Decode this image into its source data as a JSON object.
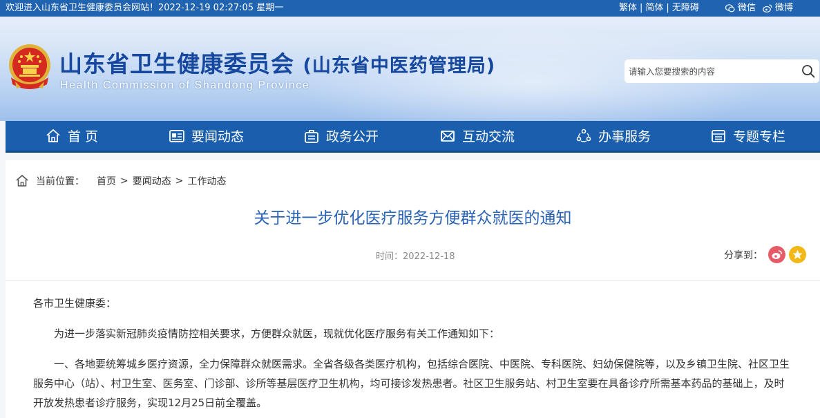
{
  "topbar": {
    "welcome": "欢迎进入山东省卫生健康委员会网站！2022-12-19 02:27:05 星期一",
    "lang_traditional": "繁体",
    "lang_simplified": "简体",
    "accessibility": "无障碍",
    "sep": "|",
    "wechat": "微信",
    "weibo": "微博"
  },
  "header": {
    "title_cn": "山东省卫生健康委员会",
    "title_cn_sub": "(山东省中医药管理局)",
    "title_en": "Health Commission of Shandong Province",
    "search_placeholder": "请输入您要搜索的内容"
  },
  "nav": {
    "items": [
      {
        "label": "首 页",
        "icon": "home-icon"
      },
      {
        "label": "要闻动态",
        "icon": "news-icon"
      },
      {
        "label": "政务公开",
        "icon": "briefcase-icon"
      },
      {
        "label": "互动交流",
        "icon": "mail-icon"
      },
      {
        "label": "办事服务",
        "icon": "service-icon"
      },
      {
        "label": "专题专栏",
        "icon": "column-icon"
      }
    ]
  },
  "breadcrumb": {
    "label": "当前位置：",
    "items": [
      "首页",
      "要闻动态",
      "工作动态"
    ],
    "sep": ">"
  },
  "article": {
    "title": "关于进一步优化医疗服务方便群众就医的通知",
    "time": "时间：2022-12-18",
    "share_label": "分享到：",
    "salutation": "各市卫生健康委：",
    "intro": "为进一步落实新冠肺炎疫情防控相关要求，方便群众就医，现就优化医疗服务有关工作通知如下：",
    "para1": "一、各地要统筹城乡医疗资源，全力保障群众就医需求。全省各级各类医疗机构，包括综合医院、中医院、专科医院、妇幼保健院等，以及乡镇卫生院、社区卫生服务中心（站）、村卫生室、医务室、门诊部、诊所等基层医疗卫生机构，均可接诊发热患者。社区卫生服务站、村卫生室要在具备诊疗所需基本药品的基础上，及时开放发热患者诊疗服务，实现12月25日前全覆盖。"
  },
  "colors": {
    "topbar": "#1f63b1",
    "nav": "#1a5fad",
    "title": "#1648a0",
    "article_title": "#2a63b4"
  }
}
